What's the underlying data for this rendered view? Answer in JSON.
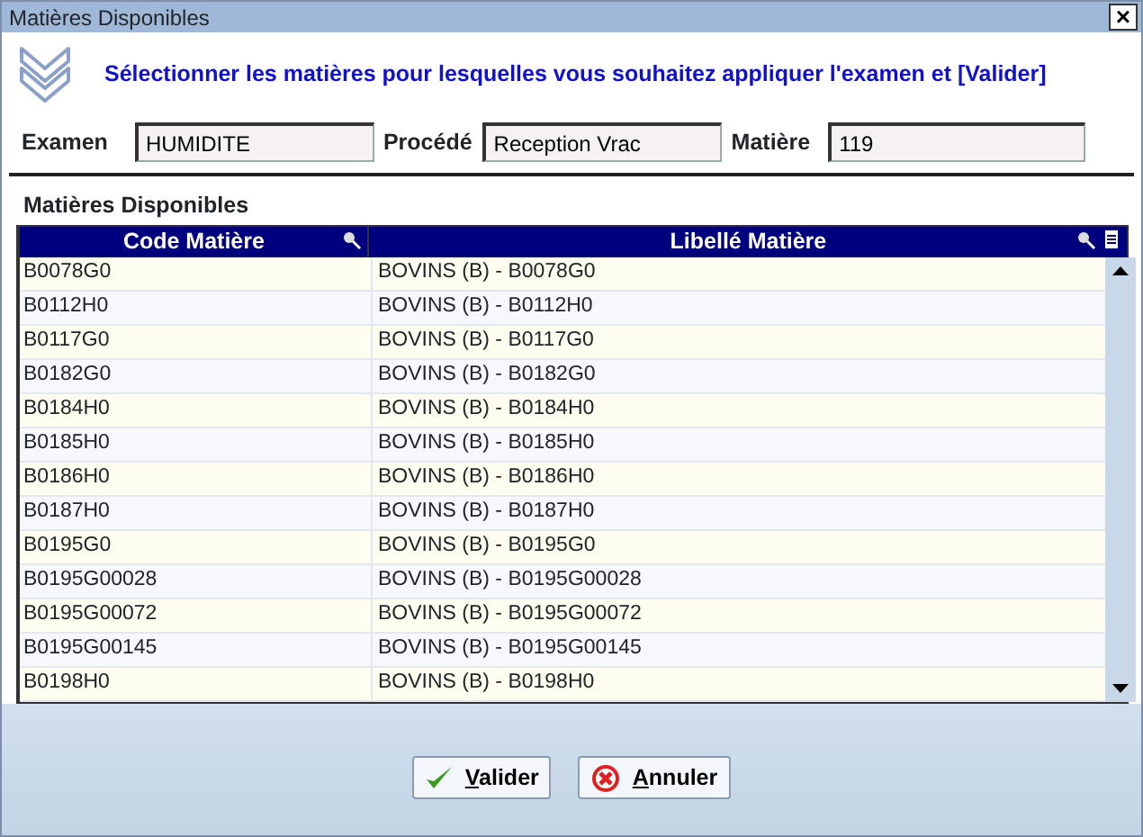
{
  "window": {
    "title": "Matières Disponibles",
    "close": "×"
  },
  "instruction": "Sélectionner les matières pour lesquelles vous souhaitez appliquer l'examen et [Valider]",
  "fields": [
    {
      "label": "Examen",
      "value": "HUMIDITE"
    },
    {
      "label": "Procédé",
      "value": "Reception Vrac"
    },
    {
      "label": "Matière",
      "value": "119"
    }
  ],
  "section_title": "Matières Disponibles",
  "table": {
    "columns": [
      "Code Matière",
      "Libellé Matière"
    ],
    "rows": [
      [
        "B0078G0",
        "BOVINS (B) - B0078G0"
      ],
      [
        "B0112H0",
        "BOVINS (B) - B0112H0"
      ],
      [
        "B0117G0",
        "BOVINS (B) - B0117G0"
      ],
      [
        "B0182G0",
        "BOVINS (B) - B0182G0"
      ],
      [
        "B0184H0",
        "BOVINS (B) - B0184H0"
      ],
      [
        "B0185H0",
        "BOVINS (B) - B0185H0"
      ],
      [
        "B0186H0",
        "BOVINS (B) - B0186H0"
      ],
      [
        "B0187H0",
        "BOVINS (B) - B0187H0"
      ],
      [
        "B0195G0",
        "BOVINS (B) - B0195G0"
      ],
      [
        "B0195G00028",
        "BOVINS (B) - B0195G00028"
      ],
      [
        "B0195G00072",
        "BOVINS (B) - B0195G00072"
      ],
      [
        "B0195G00145",
        "BOVINS (B) - B0195G00145"
      ],
      [
        "B0198H0",
        "BOVINS (B) - B0198H0"
      ]
    ]
  },
  "buttons": [
    {
      "kind": "ok",
      "label": "Valider"
    },
    {
      "kind": "cancel",
      "label": "Annuler"
    }
  ]
}
